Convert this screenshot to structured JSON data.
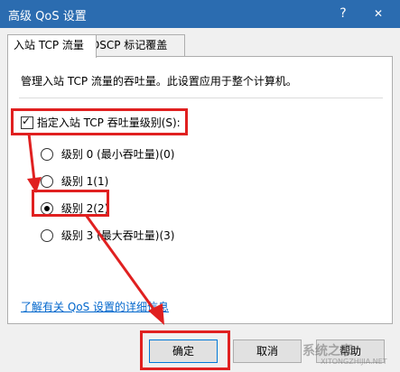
{
  "window": {
    "title": "高级 QoS 设置",
    "help": "?",
    "close": "✕"
  },
  "tabs": [
    {
      "label": "入站 TCP 流量",
      "active": true
    },
    {
      "label": "DSCP 标记覆盖",
      "active": false
    }
  ],
  "panel": {
    "description": "管理入站 TCP 流量的吞吐量。此设置应用于整个计算机。",
    "checkbox": {
      "label": "指定入站 TCP 吞吐量级别(S):",
      "checked": true
    },
    "radios": [
      {
        "label": "级别 0 (最小吞吐量)(0)",
        "selected": false
      },
      {
        "label": "级别 1(1)",
        "selected": false
      },
      {
        "label": "级别 2(2)",
        "selected": true
      },
      {
        "label": "级别 3 (最大吞吐量)(3)",
        "selected": false
      }
    ],
    "link": "了解有关 QoS 设置的详细信息"
  },
  "buttons": {
    "ok": "确定",
    "cancel": "取消",
    "help": "帮助"
  },
  "watermark": {
    "text": "系统之家",
    "sub": "XITONGZHIJIA.NET"
  },
  "colors": {
    "titlebar": "#2b6cb0",
    "annotation": "#e02020",
    "link": "#0066cc"
  }
}
